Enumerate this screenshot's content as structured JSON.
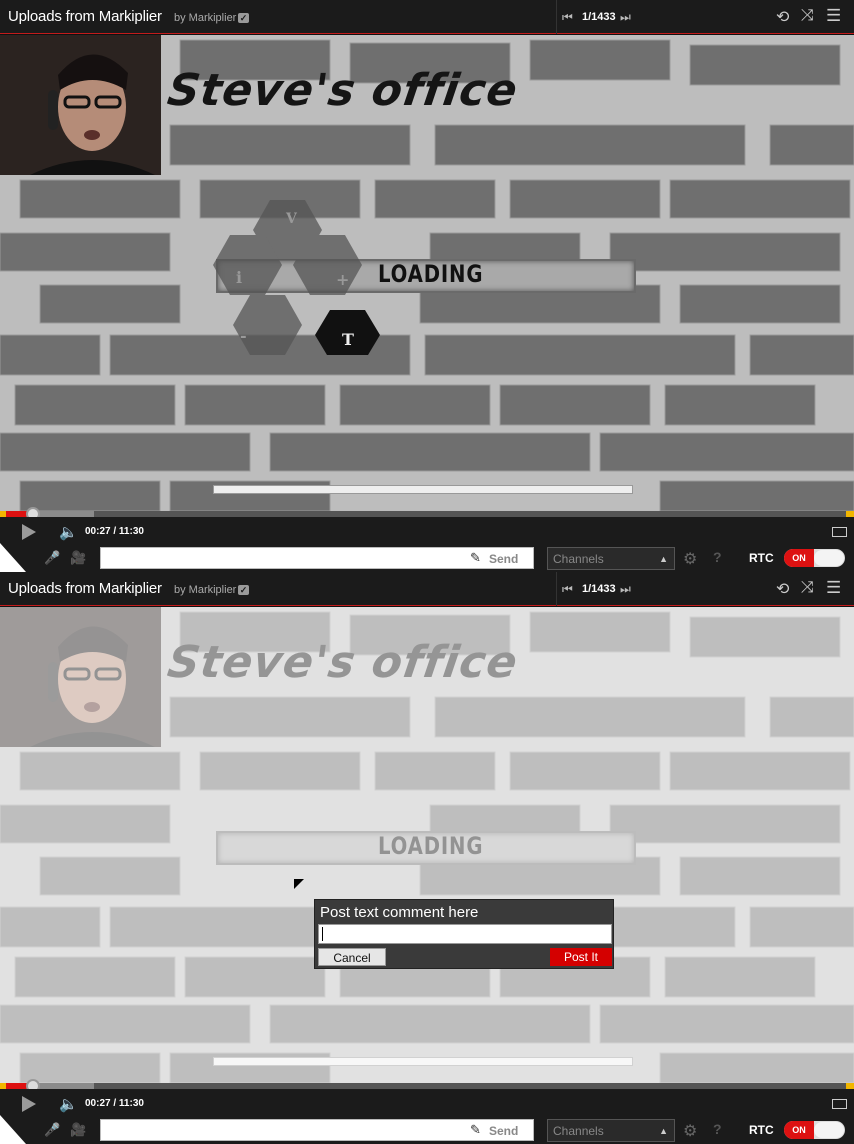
{
  "header": {
    "title": "Uploads from Markiplier",
    "by_label": "by Markiplier",
    "verified_icon": "check-icon",
    "playlist_position": "1/1433",
    "icons": [
      "previous-icon",
      "next-icon",
      "loop-icon",
      "shuffle-icon",
      "playlist-icon"
    ]
  },
  "video": {
    "scene_text": "Steve's office",
    "loading_text": "LOADING",
    "logo_letters": [
      "V",
      "i",
      "+",
      "-",
      "T"
    ]
  },
  "player": {
    "time": "00:27 / 11:30",
    "progress_fraction": 0.039,
    "buffered_fraction": 0.11
  },
  "comment_bar": {
    "send_label": "Send",
    "channels_placeholder": "Channels",
    "rtc_label": "RTC",
    "toggle_label": "ON"
  },
  "dialog": {
    "title": "Post text comment here",
    "cancel_label": "Cancel",
    "post_label": "Post It"
  },
  "colors": {
    "accent_red": "#d11111",
    "bar_bg": "#1b1b1b",
    "progress_yellow": "#f2b600"
  }
}
